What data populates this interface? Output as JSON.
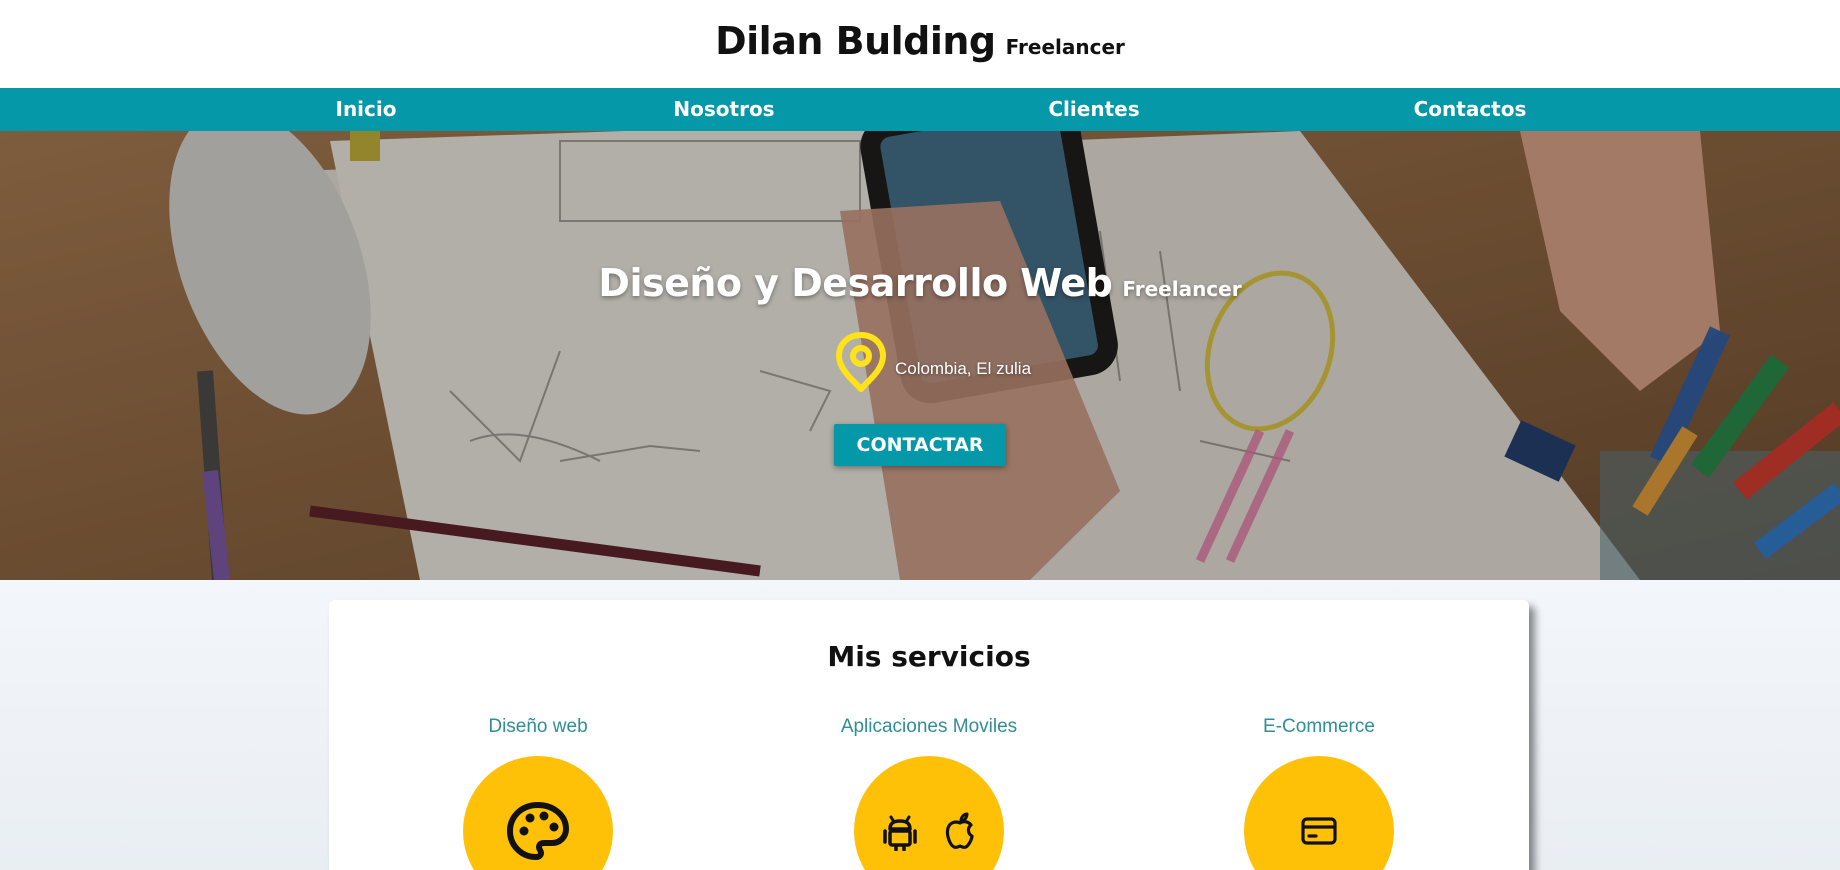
{
  "header": {
    "brand_name": "Dilan Bulding",
    "brand_sub": "Freelancer"
  },
  "nav": {
    "items": [
      {
        "label": "Inicio"
      },
      {
        "label": "Nosotros"
      },
      {
        "label": "Clientes"
      },
      {
        "label": "Contactos"
      }
    ]
  },
  "hero": {
    "title": "Diseño y Desarrollo Web",
    "subtitle": "Freelancer",
    "location": "Colombia, El zulia",
    "cta_label": "CONTACTAR",
    "location_icon": "map-pin-icon"
  },
  "services": {
    "title": "Mis servicios",
    "items": [
      {
        "label": "Diseño web",
        "icons": [
          "palette-icon"
        ]
      },
      {
        "label": "Aplicaciones Moviles",
        "icons": [
          "android-icon",
          "apple-icon"
        ]
      },
      {
        "label": "E-Commerce",
        "icons": [
          "credit-card-icon"
        ]
      }
    ]
  },
  "colors": {
    "accent": "#0598a8",
    "yellow": "#ffc107",
    "label_teal": "#2f8e96",
    "pin_yellow": "#ffe21a"
  }
}
